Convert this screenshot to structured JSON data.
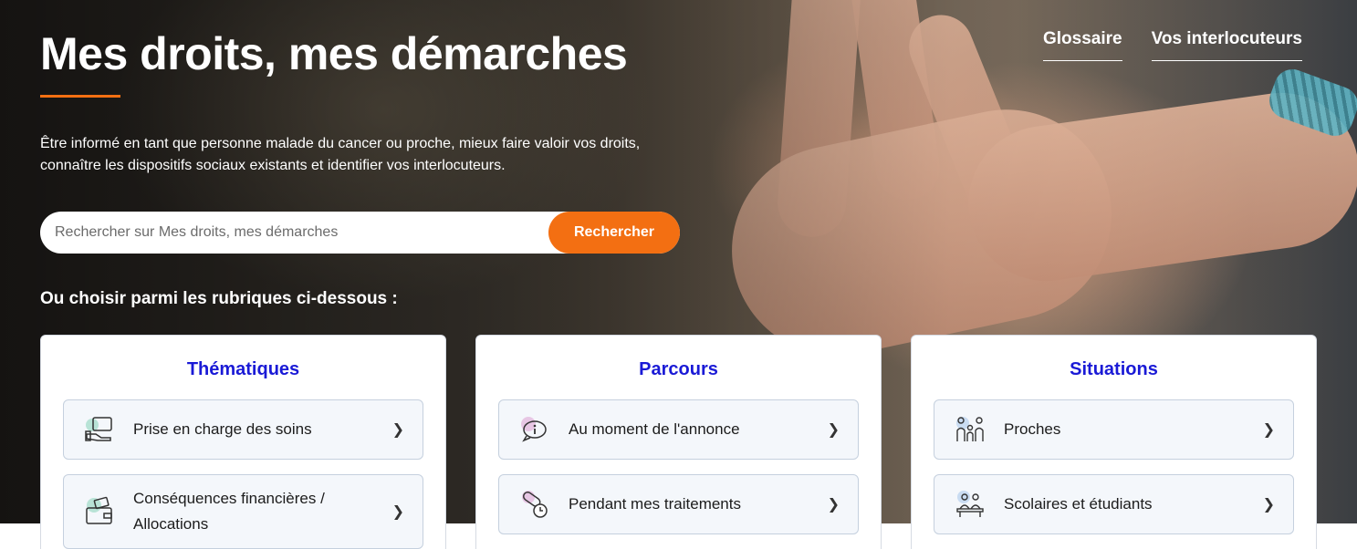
{
  "header": {
    "title": "Mes droits, mes démarches",
    "intro": "Être informé en tant que personne malade du cancer ou proche, mieux faire valoir vos droits, connaître les dispositifs sociaux existants et identifier vos interlocuteurs.",
    "nav": [
      {
        "label": "Glossaire"
      },
      {
        "label": "Vos interlocuteurs"
      }
    ]
  },
  "search": {
    "placeholder": "Rechercher sur Mes droits, mes démarches",
    "button_label": "Rechercher"
  },
  "choose_label": "Ou choisir parmi les rubriques ci-dessous :",
  "colors": {
    "accent": "#f36f12",
    "card_title": "#1a1ad6"
  },
  "cards": [
    {
      "title": "Thématiques",
      "items": [
        {
          "label": "Prise en charge des soins",
          "icon": "care-payment-icon"
        },
        {
          "label": "Conséquences financières / Allocations",
          "icon": "wallet-icon"
        }
      ]
    },
    {
      "title": "Parcours",
      "items": [
        {
          "label": "Au moment de l'annonce",
          "icon": "info-bubble-icon"
        },
        {
          "label": "Pendant mes traitements",
          "icon": "pill-clock-icon"
        }
      ]
    },
    {
      "title": "Situations",
      "items": [
        {
          "label": "Proches",
          "icon": "family-icon"
        },
        {
          "label": "Scolaires et étudiants",
          "icon": "students-icon"
        }
      ]
    }
  ]
}
